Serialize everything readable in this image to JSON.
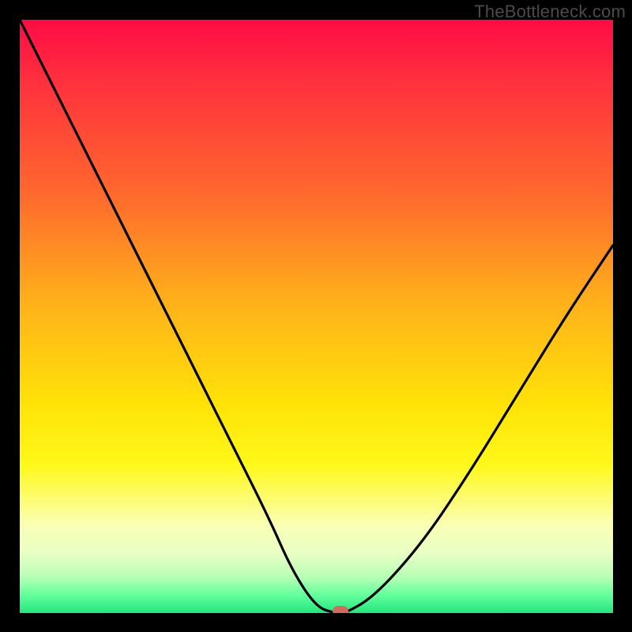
{
  "watermark": "TheBottleneck.com",
  "chart_data": {
    "type": "line",
    "title": "",
    "xlabel": "",
    "ylabel": "",
    "xlim": [
      0,
      1
    ],
    "ylim": [
      0,
      1
    ],
    "series": [
      {
        "name": "bottleneck-curve",
        "x": [
          0.0,
          0.06,
          0.12,
          0.18,
          0.24,
          0.3,
          0.36,
          0.42,
          0.46,
          0.5,
          0.53,
          0.55,
          0.6,
          0.68,
          0.76,
          0.84,
          0.92,
          1.0
        ],
        "values": [
          1.0,
          0.88,
          0.76,
          0.64,
          0.52,
          0.4,
          0.28,
          0.16,
          0.07,
          0.01,
          0.0,
          0.0,
          0.03,
          0.12,
          0.24,
          0.37,
          0.5,
          0.62
        ]
      }
    ],
    "marker": {
      "x": 0.54,
      "y": 0.002,
      "label": "optimal-point"
    },
    "gradient_stops": [
      {
        "pos": 0.0,
        "color": "#ff0b45"
      },
      {
        "pos": 0.3,
        "color": "#ff6b2d"
      },
      {
        "pos": 0.65,
        "color": "#ffe308"
      },
      {
        "pos": 0.9,
        "color": "#e8ffc4"
      },
      {
        "pos": 1.0,
        "color": "#23e57c"
      }
    ]
  }
}
